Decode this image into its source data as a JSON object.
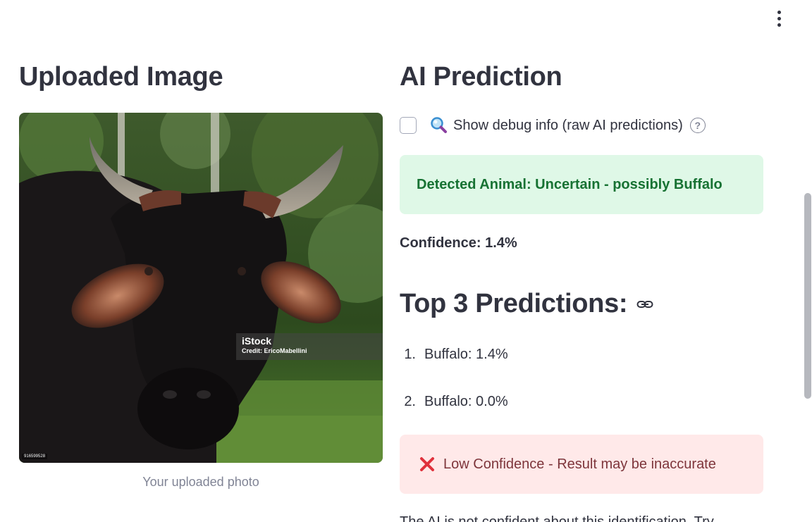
{
  "menu": {
    "icon": "vertical-ellipsis-icon"
  },
  "left_column": {
    "title": "Uploaded Image",
    "photo": {
      "watermark_brand": "iStock",
      "watermark_credit": "Credit: EricoMabellini",
      "stock_id": "916599528"
    },
    "caption": "Your uploaded photo"
  },
  "right_column": {
    "title": "AI Prediction",
    "debug_checkbox": {
      "checked": false,
      "icon": "magnifier-icon",
      "label": "Show debug info (raw AI predictions)",
      "help_icon": "question-circle-icon"
    },
    "success_alert": {
      "text": "Detected Animal: Uncertain - possibly Buffalo",
      "color": "#177233",
      "background": "#dff8e7"
    },
    "confidence": "Confidence: 1.4%",
    "top3": {
      "heading": "Top 3 Predictions:",
      "anchor_icon": "link-icon",
      "items": [
        {
          "number": "1.",
          "text": "Buffalo: 1.4%"
        },
        {
          "number": "2.",
          "text": "Buffalo: 0.0%"
        }
      ]
    },
    "error_alert": {
      "icon": "red-x-icon",
      "text": "Low Confidence - Result may be inaccurate",
      "color": "#7d353b",
      "background": "#ffe9e9"
    },
    "partial_text": "The AI is not confident about this identification. Try"
  }
}
